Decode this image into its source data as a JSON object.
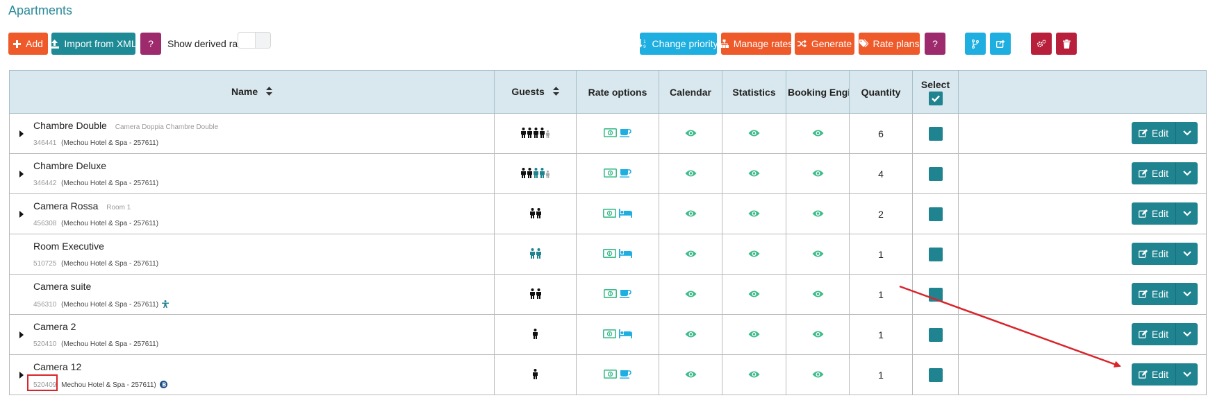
{
  "page_title": "Apartments",
  "toolbar": {
    "add_label": "Add",
    "import_label": "Import from XML",
    "help_label": "?",
    "show_derived_label": "Show derived rates",
    "change_priority_label": "Change priority",
    "manage_rates_label": "Manage rates",
    "generate_label": "Generate",
    "rate_plans_label": "Rate plans",
    "help2_label": "?"
  },
  "columns": {
    "name": "Name",
    "guests": "Guests",
    "rate_options": "Rate options",
    "calendar": "Calendar",
    "statistics": "Statistics",
    "booking_engine": "Booking Engine B",
    "quantity": "Quantity",
    "select": "Select"
  },
  "edit_label": "Edit",
  "rows": [
    {
      "name": "Chambre Double",
      "alt": "Camera Doppia Chambre Double",
      "id": "346441",
      "hotel": "(Mechou Hotel & Spa - 257611)",
      "quantity": "6",
      "caret": true,
      "guests": [
        "b",
        "b",
        "b",
        "b",
        "g"
      ],
      "rate2": "cup"
    },
    {
      "name": "Chambre Deluxe",
      "alt": "",
      "id": "346442",
      "hotel": "(Mechou Hotel & Spa - 257611)",
      "quantity": "4",
      "caret": true,
      "guests": [
        "b",
        "b",
        "t",
        "t",
        "g"
      ],
      "rate2": "cup"
    },
    {
      "name": "Camera Rossa",
      "alt": "Room 1",
      "id": "456308",
      "hotel": "(Mechou Hotel & Spa - 257611)",
      "quantity": "2",
      "caret": true,
      "guests": [
        "b",
        "b"
      ],
      "rate2": "bed"
    },
    {
      "name": "Room Executive",
      "alt": "",
      "id": "510725",
      "hotel": "(Mechou Hotel & Spa - 257611)",
      "quantity": "1",
      "caret": false,
      "guests": [
        "t",
        "t"
      ],
      "rate2": "bed"
    },
    {
      "name": "Camera suite",
      "alt": "",
      "id": "456310",
      "hotel": "(Mechou Hotel & Spa - 257611)",
      "quantity": "1",
      "caret": false,
      "guests": [
        "b",
        "b"
      ],
      "rate2": "cup",
      "badge": "person"
    },
    {
      "name": "Camera 2",
      "alt": "",
      "id": "520410",
      "hotel": "(Mechou Hotel & Spa - 257611)",
      "quantity": "1",
      "caret": true,
      "guests": [
        "b"
      ],
      "rate2": "bed"
    },
    {
      "name": "Camera 12",
      "alt": "",
      "id": "520409",
      "hotel": "Mechou Hotel & Spa - 257611)",
      "quantity": "1",
      "caret": true,
      "guests": [
        "b"
      ],
      "rate2": "cup",
      "badge": "b",
      "highlight_id": true
    }
  ],
  "colors": {
    "orange": "#ee5a2a",
    "teal": "#1e8a95",
    "purple": "#9c2a6d",
    "blue": "#1eaee0",
    "crimson": "#b81f3a",
    "eye": "#3dbb8a",
    "guest_teal": "#1f8490",
    "annotation": "#d9242b"
  }
}
